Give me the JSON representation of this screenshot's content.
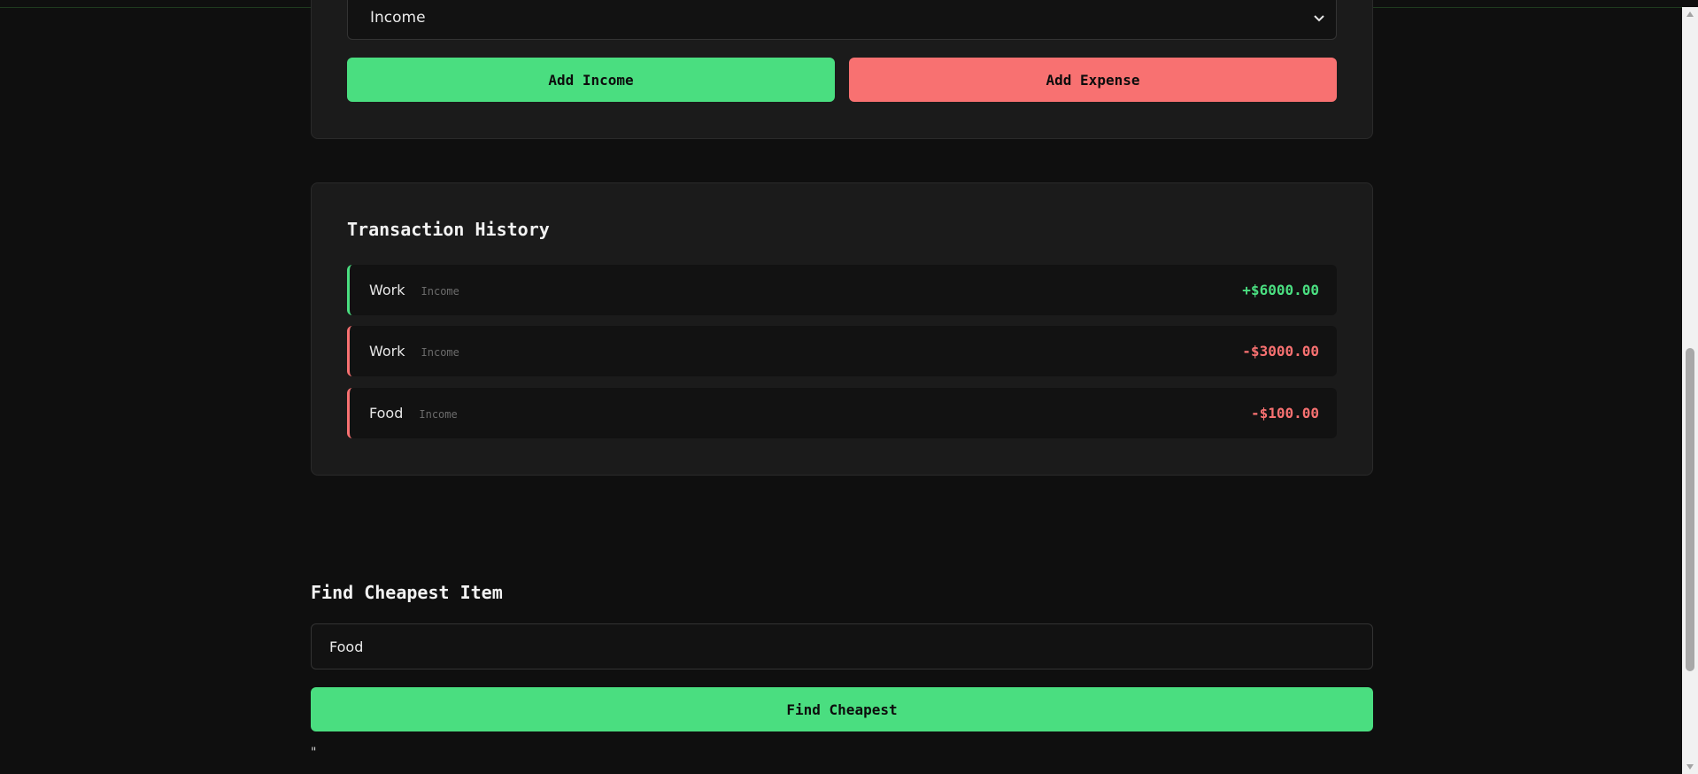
{
  "form": {
    "category_select_value": "Income",
    "add_income_label": "Add Income",
    "add_expense_label": "Add Expense"
  },
  "history": {
    "title": "Transaction History",
    "transactions": [
      {
        "name": "Work",
        "type": "Income",
        "amount": "+$6000.00",
        "direction": "positive"
      },
      {
        "name": "Work",
        "type": "Income",
        "amount": "-$3000.00",
        "direction": "negative"
      },
      {
        "name": "Food",
        "type": "Income",
        "amount": "-$100.00",
        "direction": "negative"
      }
    ]
  },
  "find": {
    "title": "Find Cheapest Item",
    "input_value": "Food",
    "button_label": "Find Cheapest",
    "result_text": "\""
  },
  "colors": {
    "background": "#0f0f0f",
    "card": "#1b1b1b",
    "accent_green": "#4ade80",
    "accent_red": "#f87171"
  },
  "icons": {
    "select": "chevron-down-icon",
    "scroll_up": "triangle-up-icon",
    "scroll_down": "triangle-down-icon"
  }
}
